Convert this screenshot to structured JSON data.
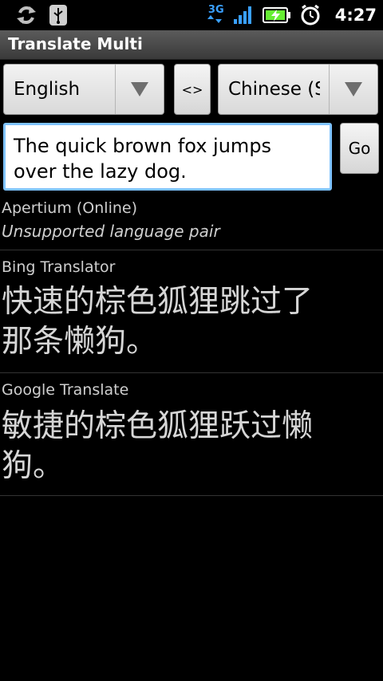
{
  "status_bar": {
    "time": "4:27",
    "network": "3G",
    "icons": [
      "sync-icon",
      "usb-icon",
      "network-3g-icon",
      "signal-icon",
      "battery-charging-icon",
      "alarm-icon"
    ]
  },
  "app": {
    "title": "Translate Multi"
  },
  "translator": {
    "source_language": "English",
    "target_language": "Chinese (Simplified)",
    "target_language_visible": "Chinese (S",
    "swap_label": "<>",
    "input_text_line1": "The quick brown fox jumps",
    "input_text_line2": "over the lazy dog.",
    "go_label": "Go"
  },
  "results": [
    {
      "provider": "Apertium (Online)",
      "message": "Unsupported language pair"
    },
    {
      "provider": "Bing Translator",
      "translation_line1": "快速的棕色狐狸跳过了",
      "translation_line2": "那条懒狗。"
    },
    {
      "provider": "Google Translate",
      "translation_line1": "敏捷的棕色狐狸跃过懒",
      "translation_line2": "狗。"
    }
  ],
  "colors": {
    "background": "#000000",
    "title_bar": "#4a4a4a",
    "input_focus_border": "#7fc3ff",
    "status_accent": "#3aa0ff",
    "battery_fill": "#66ee33"
  }
}
